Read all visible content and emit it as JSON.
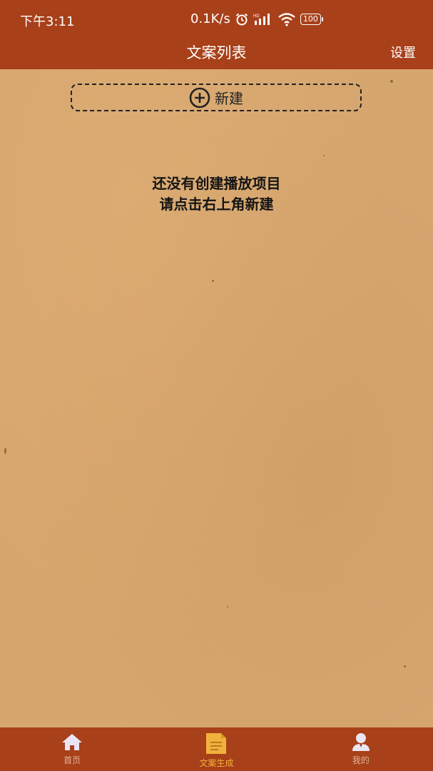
{
  "status_bar": {
    "time": "下午3:11",
    "network_speed": "0.1K/s",
    "battery": "100"
  },
  "header": {
    "title": "文案列表",
    "settings_label": "设置"
  },
  "new_button": {
    "label": "新建",
    "icon": "plus-circle-icon"
  },
  "empty_state": {
    "line1": "还没有创建播放项目",
    "line2": "请点击右上角新建"
  },
  "tabs": [
    {
      "label": "首页",
      "icon": "home-icon",
      "active": false
    },
    {
      "label": "文案生成",
      "icon": "document-icon",
      "active": true
    },
    {
      "label": "我的",
      "icon": "user-icon",
      "active": false
    }
  ],
  "colors": {
    "header_bg": "#a8401a",
    "paper_bg": "#d6a66f",
    "active_tab": "#f0b23c"
  }
}
